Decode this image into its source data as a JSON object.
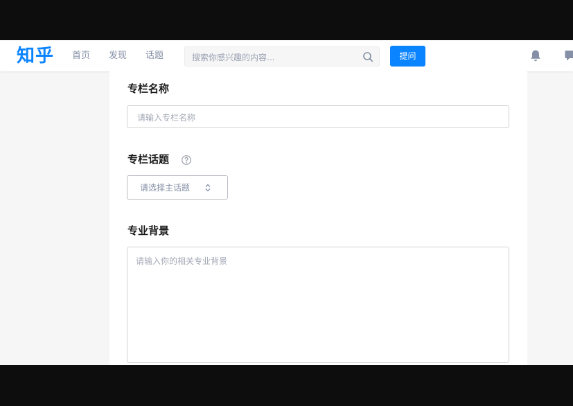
{
  "header": {
    "logo": "知乎",
    "nav": [
      "首页",
      "发现",
      "话题"
    ],
    "search_placeholder": "搜索你感兴趣的内容...",
    "ask_button": "提问",
    "icons": [
      "search-icon",
      "bell-icon",
      "message-icon"
    ],
    "accent_color": "#0a84ff"
  },
  "form": {
    "column_name": {
      "label": "专栏名称",
      "placeholder": "请输入专栏名称"
    },
    "column_topic": {
      "label": "专栏话题",
      "help_icon": "question-circle-icon",
      "select_text": "请选择主话题",
      "select_icon": "up-down-arrows-icon"
    },
    "background": {
      "label": "专业背景",
      "placeholder": "请输入你的相关专业背景"
    }
  }
}
